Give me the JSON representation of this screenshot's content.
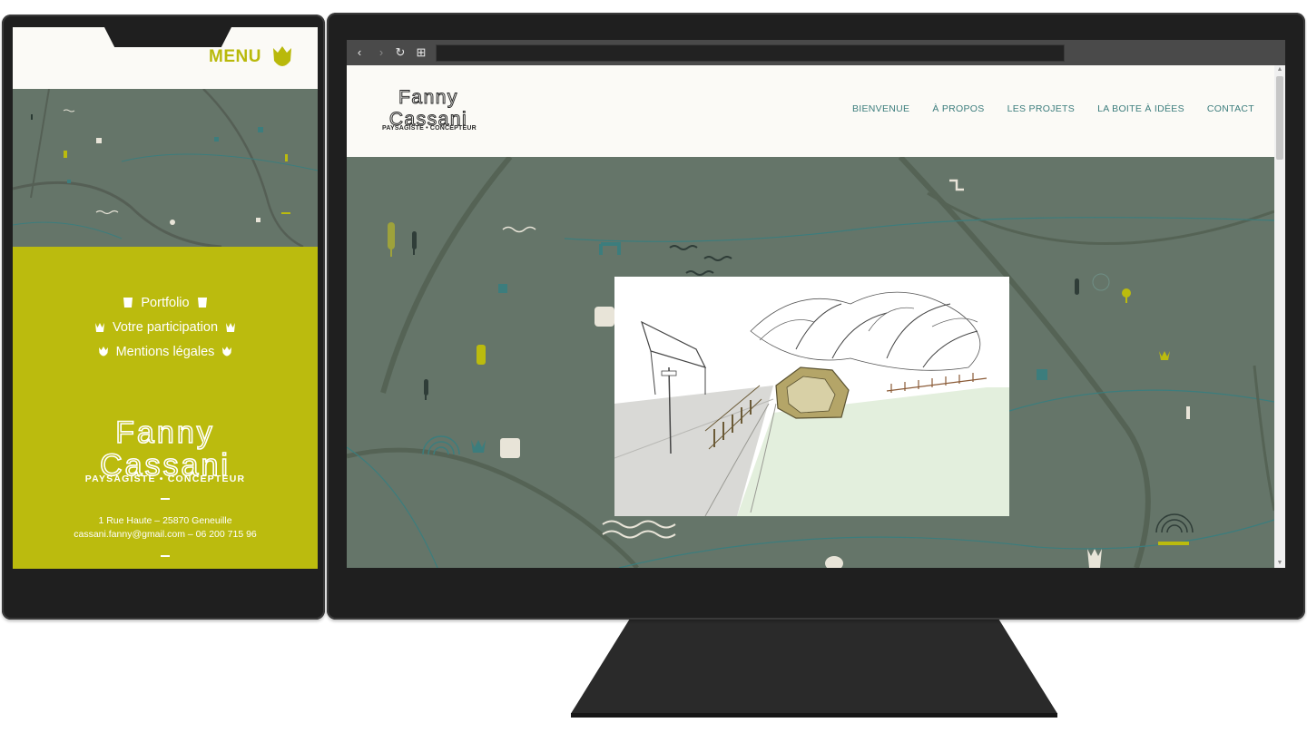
{
  "colors": {
    "sage": "#657569",
    "olive_yellow": "#bbbb0e",
    "teal": "#3c7d7d",
    "cream": "#fbfaf6"
  },
  "mobile": {
    "menu_label": "MENU",
    "menu_icon": "tulip-icon",
    "nav_items": [
      {
        "label": "Portfolio",
        "icon": "pot-icon"
      },
      {
        "label": "Votre participation",
        "icon": "crown-icon"
      },
      {
        "label": "Mentions légales",
        "icon": "tulip-icon"
      }
    ],
    "brand_line1": "Fanny",
    "brand_line2": "Cassani",
    "tagline": "PAYSAGISTE • CONCEPTEUR",
    "address": "1 Rue Haute – 25870 Geneuille",
    "contact": "cassani.fanny@gmail.com – 06 200 715 96"
  },
  "desktop": {
    "brand_line1": "Fanny",
    "brand_line2": "Cassani",
    "tagline": "PAYSAGISTE • CONCEPTEUR",
    "nav": [
      "BIENVENUE",
      "À PROPOS",
      "LES PROJETS",
      "LA BOITE À IDÉES",
      "CONTACT"
    ],
    "browser_controls": {
      "back": "‹",
      "forward": "›",
      "reload": "↻",
      "apps": "⊞"
    }
  }
}
